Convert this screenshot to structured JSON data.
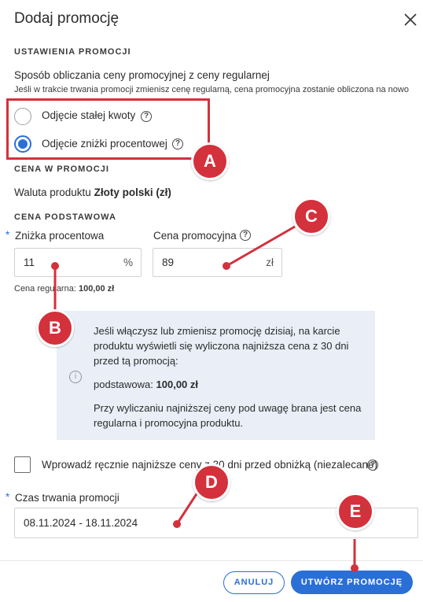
{
  "dialog": {
    "title": "Dodaj promocję"
  },
  "promo_settings": {
    "section_label": "USTAWIENIA PROMOCJI",
    "calc_title": "Sposób obliczania ceny promocyjnej z ceny regularnej",
    "calc_note": "Jeśli w trakcie trwania promocji zmienisz cenę regularną, cena promocyjna zostanie obliczona na nowo",
    "options": [
      {
        "label": "Odjęcie stałej kwoty",
        "checked": false
      },
      {
        "label": "Odjęcie zniżki procentowej",
        "checked": true
      }
    ]
  },
  "promo_price": {
    "section_label": "CENA W PROMOCJI",
    "currency_prefix": "Waluta produktu",
    "currency_value": "Złoty polski (zł)"
  },
  "base_price": {
    "section_label": "CENA PODSTAWOWA",
    "discount_label": "Zniżka procentowa",
    "discount_value": "11",
    "discount_unit": "%",
    "promo_price_label": "Cena promocyjna",
    "promo_price_value": "89",
    "promo_price_unit": "zł",
    "regular_price_label": "Cena regularna:",
    "regular_price_value": "100,00 zł",
    "required_mark": "*"
  },
  "info": {
    "line1": "Jeśli włączysz lub zmienisz promocję dzisiaj, na karcie",
    "line2": "produktu wyświetli się wyliczona najniższa cena z 30 dni",
    "line3": "przed tą promocją:",
    "base_label": "podstawowa:",
    "base_value": "100,00 zł",
    "note1": "Przy wyliczaniu najniższej ceny pod uwagę brana jest cena",
    "note2": "regularna i promocyjna produktu."
  },
  "manual": {
    "label": "Wprowadź ręcznie najniższe ceny z 30 dni przed obniżką (niezalecane)",
    "checked": false
  },
  "duration": {
    "label": "Czas trwania promocji",
    "value": "08.11.2024 - 18.11.2024",
    "required_mark": "*"
  },
  "footer": {
    "cancel_label": "ANULUJ",
    "create_label": "UTWÓRZ PROMOCJĘ"
  },
  "annotations": {
    "markers": [
      "A",
      "B",
      "C",
      "D",
      "E"
    ],
    "color": "#d3313c"
  },
  "colors": {
    "accent": "#2a6fd6",
    "info_bg": "#e9eef7"
  }
}
